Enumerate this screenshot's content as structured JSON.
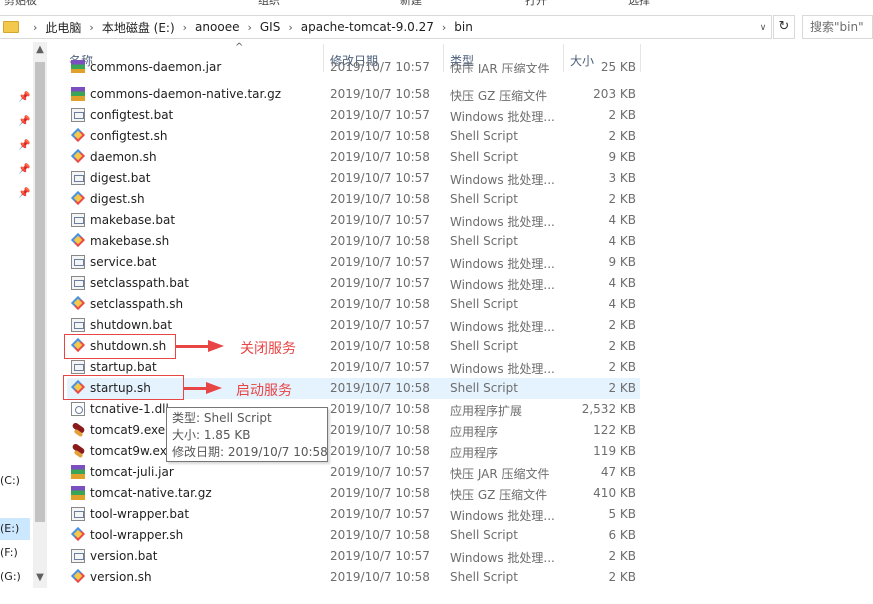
{
  "ribbon": {
    "labels": [
      "剪贴板",
      "组织",
      "新建",
      "打开",
      "选择"
    ]
  },
  "address": {
    "crumbs": [
      "此电脑",
      "本地磁盘 (E:)",
      "anooee",
      "GIS",
      "apache-tomcat-9.0.27",
      "bin"
    ],
    "separator": "›",
    "dropdown_glyph": "∨",
    "refresh_glyph": "↻",
    "search_placeholder": "搜索\"bin\""
  },
  "nav": {
    "drives": [
      "(C:)",
      "(E:)",
      "(F:)",
      "(G:)"
    ],
    "selected_drive": "(E:)"
  },
  "columns": {
    "name": "名称",
    "modified": "修改日期",
    "type": "类型",
    "size": "大小",
    "sort_glyph": "^"
  },
  "files": [
    {
      "name": "commons-daemon.jar",
      "date": "2019/10/7 10:57",
      "type": "快压 JAR 压缩文件",
      "size": "25 KB",
      "icon": "archive-icon"
    },
    {
      "name": "commons-daemon-native.tar.gz",
      "date": "2019/10/7 10:58",
      "type": "快压 GZ 压缩文件",
      "size": "203 KB",
      "icon": "archive-icon"
    },
    {
      "name": "configtest.bat",
      "date": "2019/10/7 10:57",
      "type": "Windows 批处理...",
      "size": "2 KB",
      "icon": "batch-file-icon"
    },
    {
      "name": "configtest.sh",
      "date": "2019/10/7 10:58",
      "type": "Shell Script",
      "size": "2 KB",
      "icon": "shell-script-icon"
    },
    {
      "name": "daemon.sh",
      "date": "2019/10/7 10:58",
      "type": "Shell Script",
      "size": "9 KB",
      "icon": "shell-script-icon"
    },
    {
      "name": "digest.bat",
      "date": "2019/10/7 10:57",
      "type": "Windows 批处理...",
      "size": "3 KB",
      "icon": "batch-file-icon"
    },
    {
      "name": "digest.sh",
      "date": "2019/10/7 10:58",
      "type": "Shell Script",
      "size": "2 KB",
      "icon": "shell-script-icon"
    },
    {
      "name": "makebase.bat",
      "date": "2019/10/7 10:57",
      "type": "Windows 批处理...",
      "size": "4 KB",
      "icon": "batch-file-icon"
    },
    {
      "name": "makebase.sh",
      "date": "2019/10/7 10:58",
      "type": "Shell Script",
      "size": "4 KB",
      "icon": "shell-script-icon"
    },
    {
      "name": "service.bat",
      "date": "2019/10/7 10:57",
      "type": "Windows 批处理...",
      "size": "9 KB",
      "icon": "batch-file-icon"
    },
    {
      "name": "setclasspath.bat",
      "date": "2019/10/7 10:57",
      "type": "Windows 批处理...",
      "size": "4 KB",
      "icon": "batch-file-icon"
    },
    {
      "name": "setclasspath.sh",
      "date": "2019/10/7 10:58",
      "type": "Shell Script",
      "size": "4 KB",
      "icon": "shell-script-icon"
    },
    {
      "name": "shutdown.bat",
      "date": "2019/10/7 10:57",
      "type": "Windows 批处理...",
      "size": "2 KB",
      "icon": "batch-file-icon"
    },
    {
      "name": "shutdown.sh",
      "date": "2019/10/7 10:58",
      "type": "Shell Script",
      "size": "2 KB",
      "icon": "shell-script-icon"
    },
    {
      "name": "startup.bat",
      "date": "2019/10/7 10:57",
      "type": "Windows 批处理...",
      "size": "2 KB",
      "icon": "batch-file-icon"
    },
    {
      "name": "startup.sh",
      "date": "2019/10/7 10:58",
      "type": "Shell Script",
      "size": "2 KB",
      "icon": "shell-script-icon"
    },
    {
      "name": "tcnative-1.dll",
      "date": "2019/10/7 10:58",
      "type": "应用程序扩展",
      "size": "2,532 KB",
      "icon": "dll-icon"
    },
    {
      "name": "tomcat9.exe",
      "date": "2019/10/7 10:58",
      "type": "应用程序",
      "size": "122 KB",
      "icon": "tomcat-exe-icon"
    },
    {
      "name": "tomcat9w.exe",
      "date": "2019/10/7 10:58",
      "type": "应用程序",
      "size": "119 KB",
      "icon": "tomcat-exe-icon"
    },
    {
      "name": "tomcat-juli.jar",
      "date": "2019/10/7 10:57",
      "type": "快压 JAR 压缩文件",
      "size": "47 KB",
      "icon": "archive-icon"
    },
    {
      "name": "tomcat-native.tar.gz",
      "date": "2019/10/7 10:58",
      "type": "快压 GZ 压缩文件",
      "size": "410 KB",
      "icon": "archive-icon"
    },
    {
      "name": "tool-wrapper.bat",
      "date": "2019/10/7 10:57",
      "type": "Windows 批处理...",
      "size": "5 KB",
      "icon": "batch-file-icon"
    },
    {
      "name": "tool-wrapper.sh",
      "date": "2019/10/7 10:58",
      "type": "Shell Script",
      "size": "6 KB",
      "icon": "shell-script-icon"
    },
    {
      "name": "version.bat",
      "date": "2019/10/7 10:57",
      "type": "Windows 批处理...",
      "size": "2 KB",
      "icon": "batch-file-icon"
    },
    {
      "name": "version.sh",
      "date": "2019/10/7 10:58",
      "type": "Shell Script",
      "size": "2 KB",
      "icon": "shell-script-icon"
    }
  ],
  "hovered_row": "startup.sh",
  "annotations": {
    "shutdown_label": "关闭服务",
    "startup_label": "启动服务",
    "color": "#e84545"
  },
  "tooltip": {
    "type_line": "类型: Shell Script",
    "size_line": "大小: 1.85 KB",
    "date_line": "修改日期: 2019/10/7 10:58"
  }
}
